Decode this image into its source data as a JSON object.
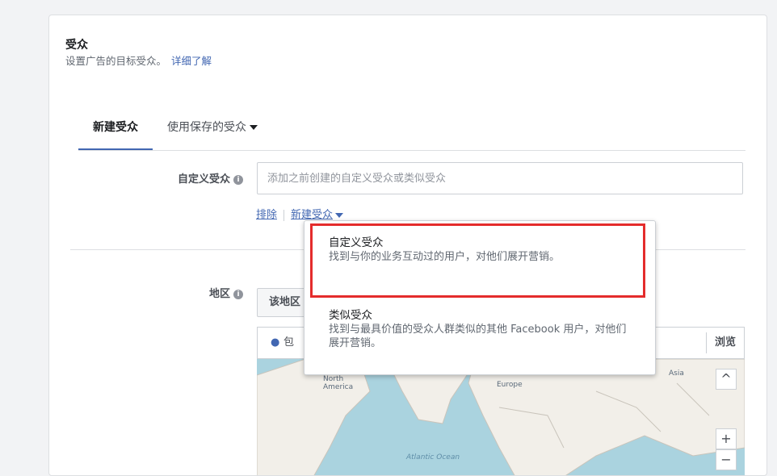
{
  "section": {
    "title": "受众",
    "subtitle": "设置广告的目标受众。",
    "learn_more": "详细了解"
  },
  "tabs": [
    {
      "label": "新建受众"
    },
    {
      "label": "使用保存的受众"
    }
  ],
  "custom_audience": {
    "label": "自定义受众",
    "placeholder": "添加之前创建的自定义受众或类似受众",
    "exclude_link": "排除",
    "create_link": "新建受众"
  },
  "location": {
    "label": "地区",
    "select_value": "该地区",
    "include_text": "包",
    "browse": "浏览",
    "map_labels": [
      "North\nAmerica",
      "Europe",
      "Asia",
      "Atlantic Ocean"
    ]
  },
  "dropdown": {
    "items": [
      {
        "title": "自定义受众",
        "desc": "找到与你的业务互动过的用户，对他们展开营销。"
      },
      {
        "title": "类似受众",
        "desc": "找到与最具价值的受众人群类似的其他 Facebook 用户，对他们展开营销。"
      }
    ]
  },
  "colors": {
    "accent": "#4267b2",
    "highlight": "#e42c2c"
  }
}
